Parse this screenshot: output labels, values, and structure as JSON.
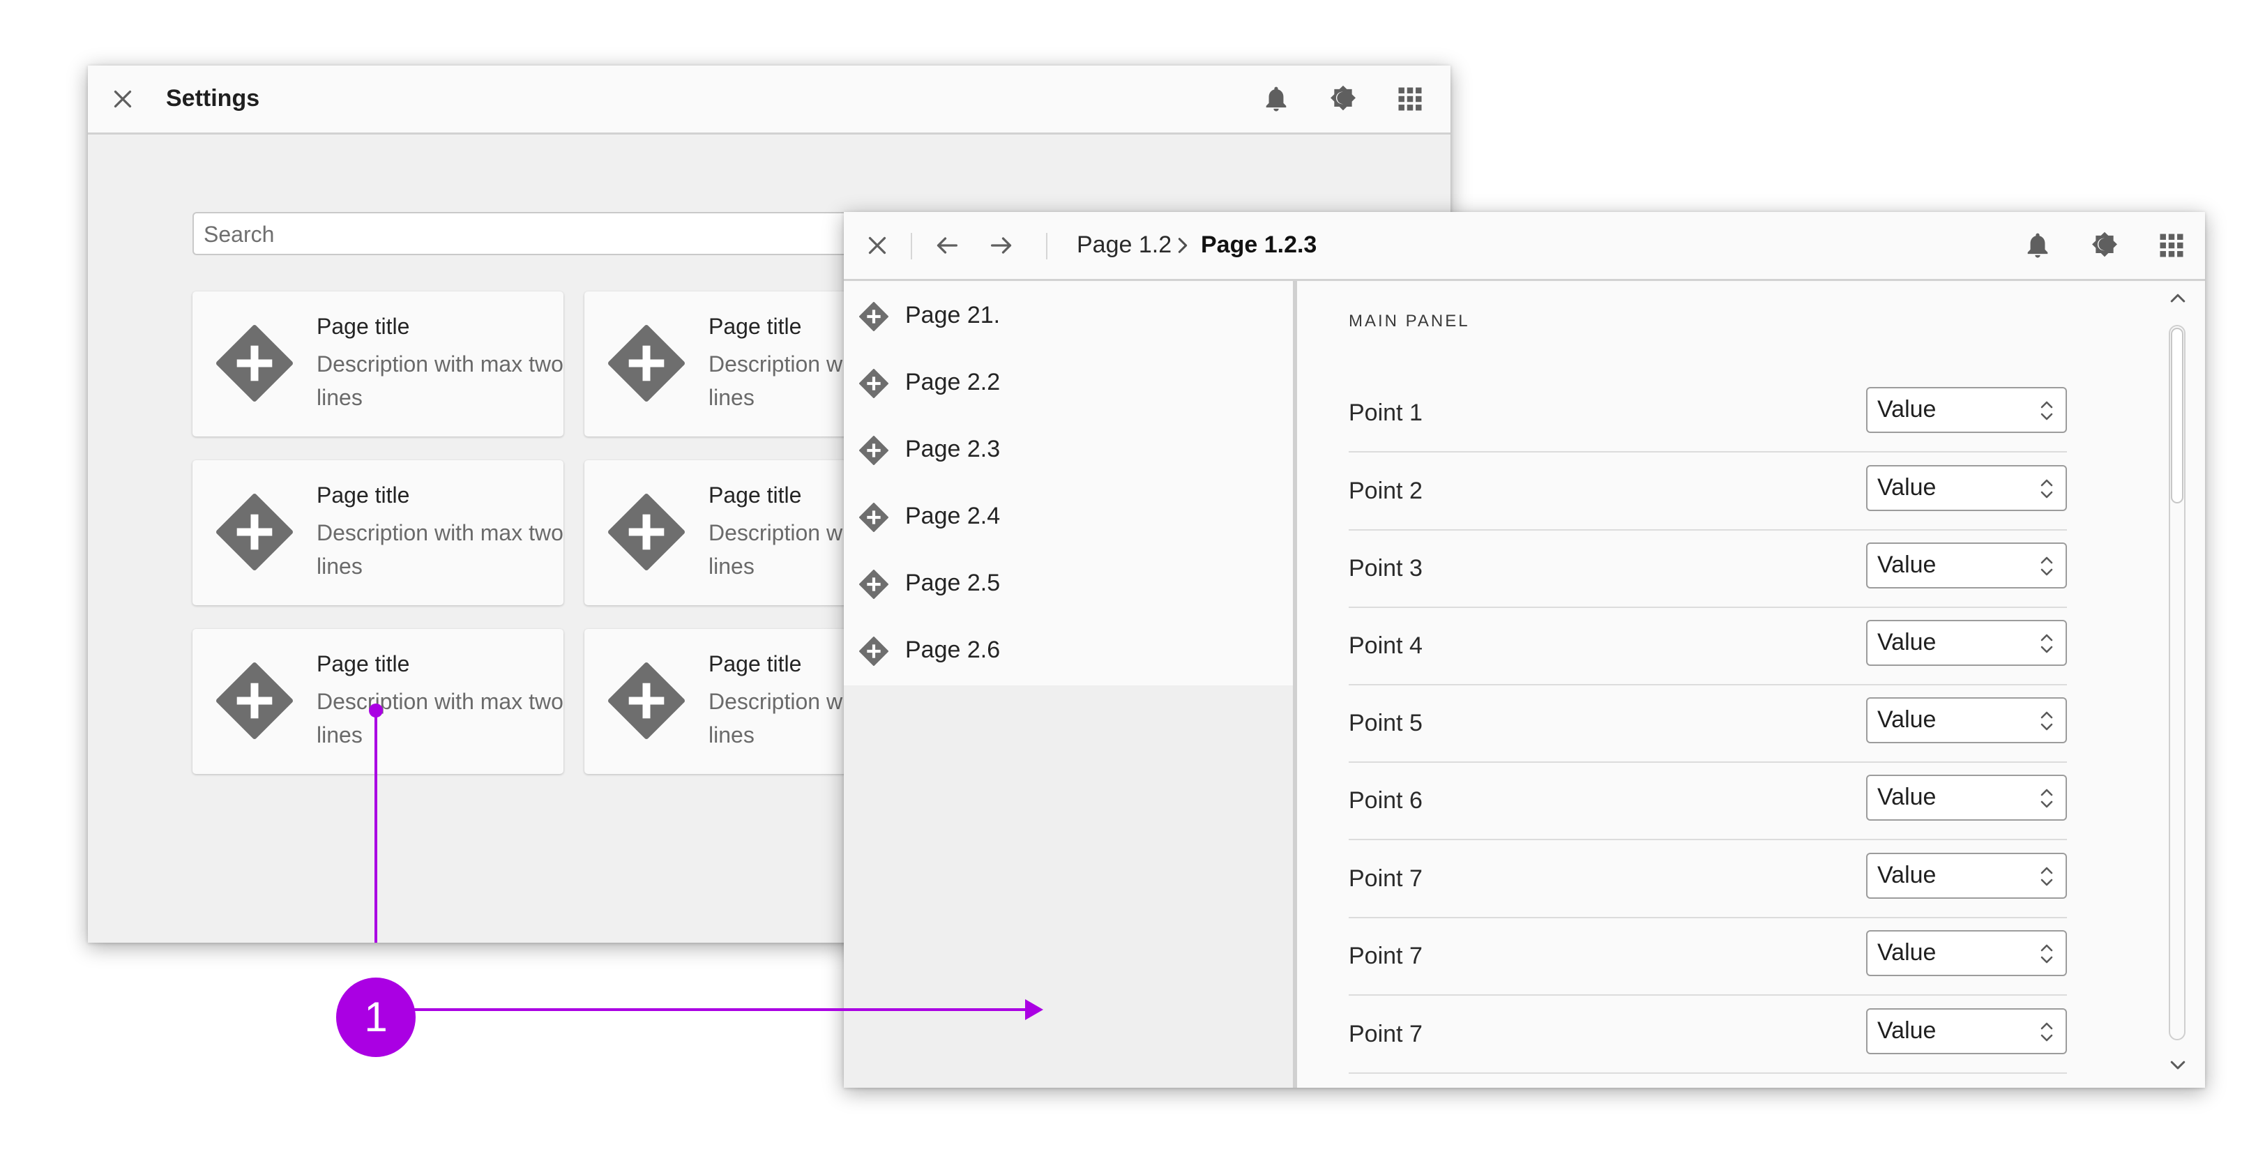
{
  "settings_window": {
    "title": "Settings",
    "close_icon": "close-icon",
    "header_icons": [
      "bell-icon",
      "theme-toggle-icon",
      "apps-grid-icon"
    ],
    "search_placeholder": "Search",
    "cards": [
      {
        "title": "Page title",
        "description": "Description with max two lines"
      },
      {
        "title": "Page title",
        "description": "Description with max two lines"
      },
      {
        "title": "Page title",
        "description": "Description with max two lines"
      },
      {
        "title": "Page title",
        "description": "Description with max two lines"
      },
      {
        "title": "Page title",
        "description": "Description with max two lines"
      },
      {
        "title": "Page title",
        "description": "Description with max two lines"
      }
    ]
  },
  "detail_window": {
    "breadcrumb": {
      "parent": "Page 1.2",
      "current": "Page 1.2.3"
    },
    "nav_items": [
      {
        "label": "Page 21."
      },
      {
        "label": "Page 2.2"
      },
      {
        "label": "Page 2.3"
      },
      {
        "label": "Page 2.4"
      },
      {
        "label": "Page 2.5"
      },
      {
        "label": "Page 2.6"
      }
    ],
    "main_panel_title": "MAIN PANEL",
    "rows": [
      {
        "label": "Point 1",
        "value": "Value"
      },
      {
        "label": "Point 2",
        "value": "Value"
      },
      {
        "label": "Point 3",
        "value": "Value"
      },
      {
        "label": "Point 4",
        "value": "Value"
      },
      {
        "label": "Point 5",
        "value": "Value"
      },
      {
        "label": "Point 6",
        "value": "Value"
      },
      {
        "label": "Point 7",
        "value": "Value"
      },
      {
        "label": "Point 7",
        "value": "Value"
      },
      {
        "label": "Point 7",
        "value": "Value"
      }
    ]
  },
  "annotation": {
    "badge": "1",
    "color": "#aa00e3"
  },
  "colors": {
    "icon_gray": "#6e6e6e",
    "header_bg": "#fafafa",
    "content_bg": "#f0f0f0"
  }
}
